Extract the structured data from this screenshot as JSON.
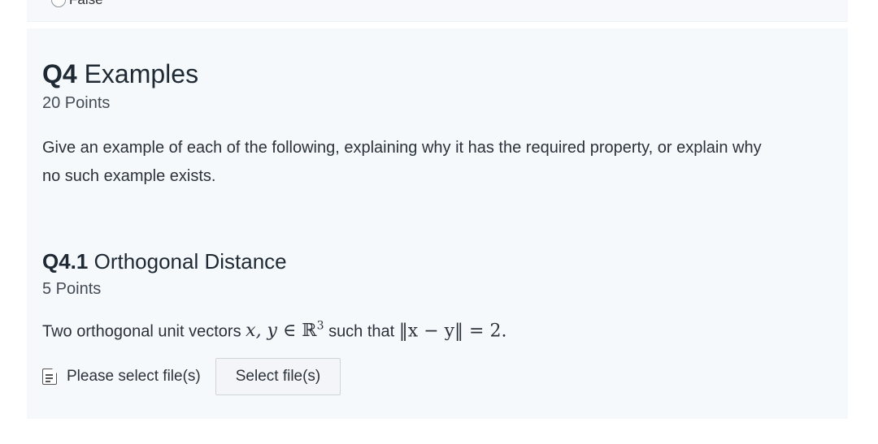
{
  "previous_question": {
    "option_label": "False"
  },
  "question": {
    "number": "Q4",
    "title": "Examples",
    "points": "20 Points",
    "description": "Give an example of each of the following, explaining why it has the required property, or explain why no such example exists."
  },
  "subquestion": {
    "number": "Q4.1",
    "title": "Orthogonal Distance",
    "points": "5 Points",
    "prompt_prefix": "Two orthogonal unit vectors",
    "math_vars": "x, y",
    "math_in": "∈",
    "math_set": "ℝ",
    "math_exp": "3",
    "prompt_mid": "such that",
    "math_norm": "‖x − y‖ = 2.",
    "upload": {
      "status": "Please select file(s)",
      "button_label": "Select file(s)",
      "icon": "document-icon"
    }
  }
}
